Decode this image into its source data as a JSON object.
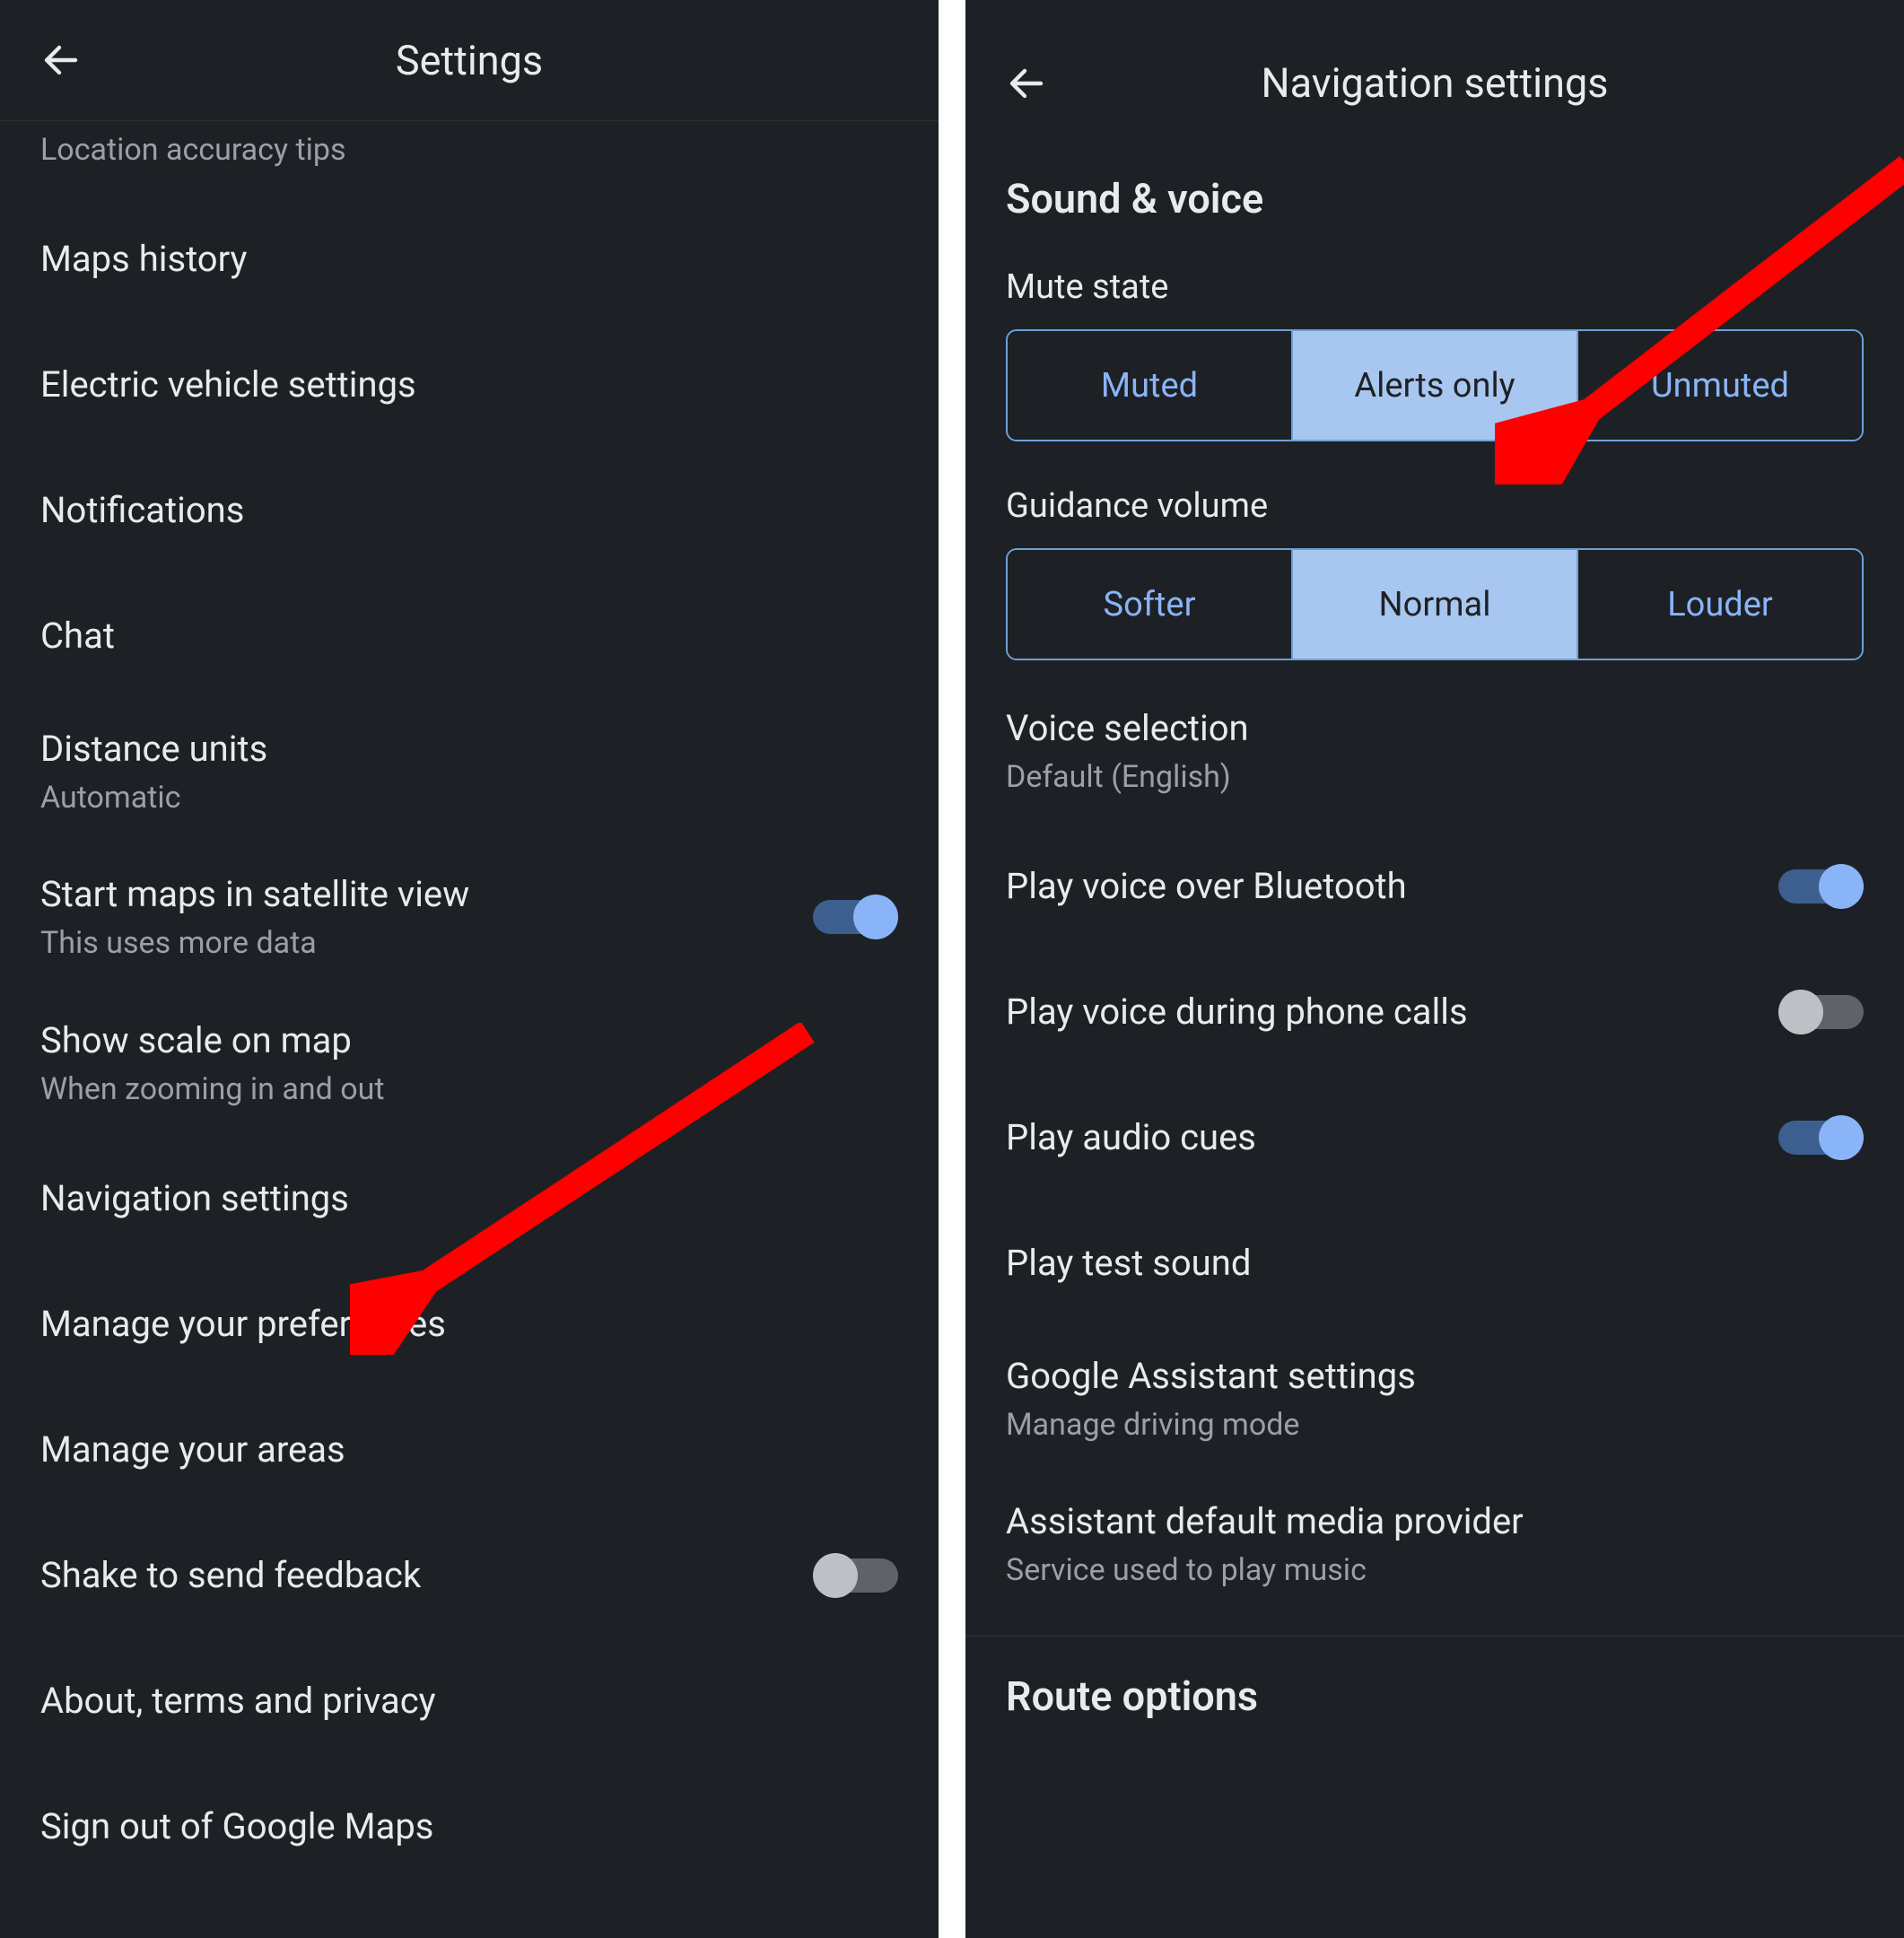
{
  "left": {
    "title": "Settings",
    "items": [
      {
        "key": "location-accuracy",
        "title": "Location accuracy tips",
        "subtitle": null,
        "toggle": null,
        "truncated": true
      },
      {
        "key": "maps-history",
        "title": "Maps history",
        "subtitle": null,
        "toggle": null
      },
      {
        "key": "ev-settings",
        "title": "Electric vehicle settings",
        "subtitle": null,
        "toggle": null
      },
      {
        "key": "notifications",
        "title": "Notifications",
        "subtitle": null,
        "toggle": null
      },
      {
        "key": "chat",
        "title": "Chat",
        "subtitle": null,
        "toggle": null
      },
      {
        "key": "distance-units",
        "title": "Distance units",
        "subtitle": "Automatic",
        "toggle": null
      },
      {
        "key": "satellite-view",
        "title": "Start maps in satellite view",
        "subtitle": "This uses more data",
        "toggle": "on"
      },
      {
        "key": "show-scale",
        "title": "Show scale on map",
        "subtitle": "When zooming in and out",
        "toggle": null
      },
      {
        "key": "navigation-settings",
        "title": "Navigation settings",
        "subtitle": null,
        "toggle": null
      },
      {
        "key": "manage-preferences",
        "title": "Manage your preferences",
        "subtitle": null,
        "toggle": null
      },
      {
        "key": "manage-areas",
        "title": "Manage your areas",
        "subtitle": null,
        "toggle": null
      },
      {
        "key": "shake-feedback",
        "title": "Shake to send feedback",
        "subtitle": null,
        "toggle": "off"
      },
      {
        "key": "about",
        "title": "About, terms and privacy",
        "subtitle": null,
        "toggle": null
      },
      {
        "key": "sign-out",
        "title": "Sign out of Google Maps",
        "subtitle": null,
        "toggle": null
      }
    ]
  },
  "right": {
    "title": "Navigation settings",
    "section1_header": "Sound & voice",
    "mute_state": {
      "label": "Mute state",
      "options": [
        "Muted",
        "Alerts only",
        "Unmuted"
      ],
      "selected": 1
    },
    "guidance_volume": {
      "label": "Guidance volume",
      "options": [
        "Softer",
        "Normal",
        "Louder"
      ],
      "selected": 1
    },
    "items": [
      {
        "key": "voice-selection",
        "title": "Voice selection",
        "subtitle": "Default (English)",
        "toggle": null
      },
      {
        "key": "voice-bluetooth",
        "title": "Play voice over Bluetooth",
        "subtitle": null,
        "toggle": "on"
      },
      {
        "key": "voice-phone-calls",
        "title": "Play voice during phone calls",
        "subtitle": null,
        "toggle": "off"
      },
      {
        "key": "audio-cues",
        "title": "Play audio cues",
        "subtitle": null,
        "toggle": "on"
      },
      {
        "key": "test-sound",
        "title": "Play test sound",
        "subtitle": null,
        "toggle": null
      },
      {
        "key": "assistant-settings",
        "title": "Google Assistant settings",
        "subtitle": "Manage driving mode",
        "toggle": null
      },
      {
        "key": "media-provider",
        "title": "Assistant default media provider",
        "subtitle": "Service used to play music",
        "toggle": null
      }
    ],
    "section2_header": "Route options"
  },
  "colors": {
    "bg": "#1d2125",
    "text_primary": "#e8eaed",
    "text_secondary": "#9aa0a6",
    "accent": "#8ab4f8",
    "segment_selected_bg": "#a8c7f0",
    "segment_border": "#6fa0d6",
    "arrow": "#ff0000"
  }
}
